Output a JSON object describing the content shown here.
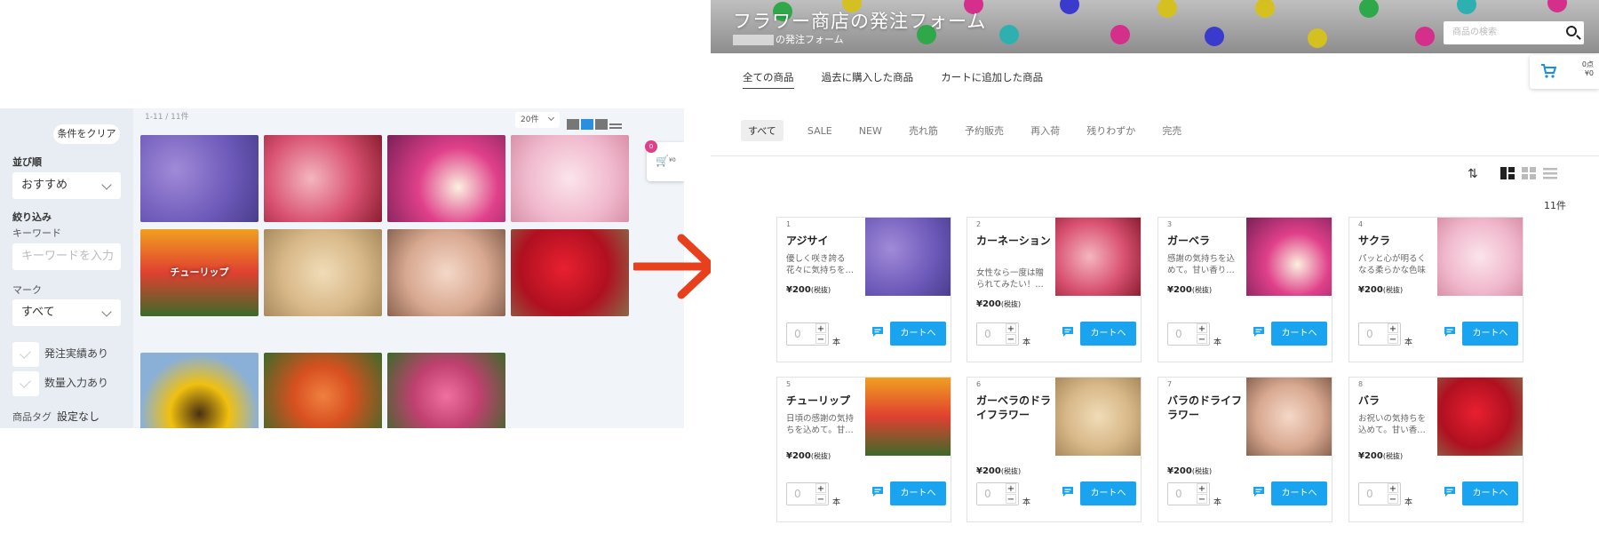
{
  "old_ui": {
    "clear_button": "条件をクリア",
    "sort_label": "並び順",
    "sort_value": "おすすめ",
    "filter_label": "絞り込み",
    "keyword_label": "キーワード",
    "keyword_placeholder": "キーワードを入力",
    "mark_label": "マーク",
    "mark_value": "すべて",
    "check_ordered": "発注実績あり",
    "check_qty": "数量入力あり",
    "tag_label": "商品タグ",
    "tag_value": "設定なし",
    "result_count": "1-11 / 11件",
    "per_page": "20件",
    "tile_label": "チューリップ",
    "cart_badge": "0",
    "cart_value": "¥0"
  },
  "new_ui": {
    "title": "フラワー商店の発注フォーム",
    "subtitle": "の発注フォーム",
    "search_placeholder": "商品の検索",
    "cart_points": "0点",
    "cart_yen": "¥0",
    "tabs": [
      "全ての商品",
      "過去に購入した商品",
      "カートに追加した商品"
    ],
    "chips": [
      "すべて",
      "SALE",
      "NEW",
      "売れ筋",
      "予約販売",
      "再入荷",
      "残りわずか",
      "完売"
    ],
    "result_count": "11件",
    "unit_label": "本",
    "qty_placeholder": "0",
    "cart_button": "カートへ",
    "products": [
      {
        "num": "1",
        "name": "アジサイ",
        "desc": "優しく咲き誇る花々に気持ちを…",
        "price": "¥200",
        "tax": "(税抜)"
      },
      {
        "num": "2",
        "name": "カーネーション",
        "desc": "女性なら一度は贈られてみたい！…",
        "price": "¥200",
        "tax": "(税抜)"
      },
      {
        "num": "3",
        "name": "ガーベラ",
        "desc": "感謝の気持ちを込めて。甘い香り…",
        "price": "¥200",
        "tax": "(税抜)"
      },
      {
        "num": "4",
        "name": "サクラ",
        "desc": "パッと心が明るくなる柔らかな色味",
        "price": "¥200",
        "tax": "(税抜)"
      },
      {
        "num": "5",
        "name": "チューリップ",
        "desc": "日頃の感謝の気持ちを込めて。甘…",
        "price": "¥200",
        "tax": "(税抜)"
      },
      {
        "num": "6",
        "name": "ガーベラのドライフラワー",
        "desc": "",
        "price": "¥200",
        "tax": "(税抜)"
      },
      {
        "num": "7",
        "name": "バラのドライフラワー",
        "desc": "",
        "price": "¥200",
        "tax": "(税抜)"
      },
      {
        "num": "8",
        "name": "バラ",
        "desc": "お祝いの気持ちを込めて。甘い香…",
        "price": "¥200",
        "tax": "(税抜)"
      }
    ]
  },
  "colors": {
    "accent": "#1aa4f0",
    "arrow": "#e8401c",
    "badge": "#e0408a"
  }
}
